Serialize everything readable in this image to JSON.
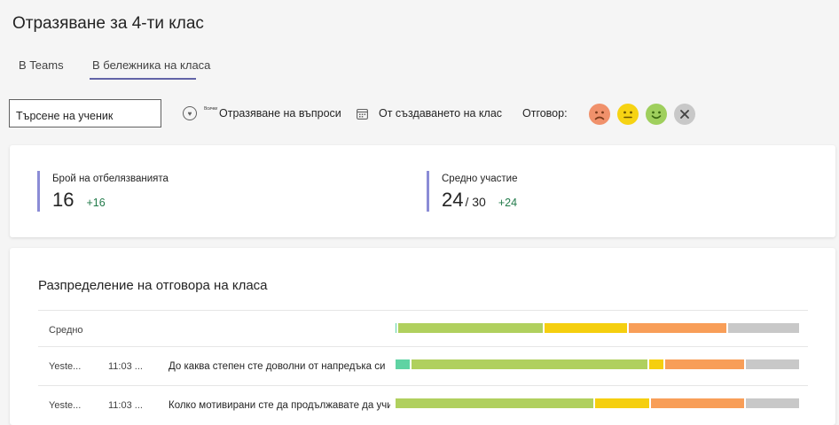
{
  "page": {
    "title": "Отразяване за 4-ти клас"
  },
  "tabs": [
    {
      "label": "В Teams"
    },
    {
      "label": "В бележника на класа"
    }
  ],
  "toolbar": {
    "search_label": "Търсене на ученик",
    "questions_mini_label": "Всички",
    "questions_filter": "Отразяване на въпроси",
    "date_filter": "От създаването на клас",
    "answer_label": "Отговор:"
  },
  "stats": [
    {
      "label": "Брой на отбелязванията",
      "value": "16",
      "of": "",
      "delta": "+16"
    },
    {
      "label": "Средно участие",
      "value": "24",
      "of": "/ 30",
      "delta": "+24"
    }
  ],
  "distribution": {
    "title": "Разпределение на отговора на класа",
    "colors": {
      "teal": "#5fd3a3",
      "green": "#b0d05e",
      "yellow": "#f5cf0f",
      "orange": "#f89e58",
      "gray": "#c8c8c8"
    },
    "rows": [
      {
        "date": "",
        "time": "",
        "question": "Средно",
        "segments": [
          0.2,
          36.5,
          21,
          24.5,
          18
        ]
      },
      {
        "date": "Yeste...",
        "time": "11:03 ...",
        "question": "До каква степен сте доволни от напредъка си",
        "segments": [
          3.5,
          60,
          3.8,
          20,
          13.5
        ]
      },
      {
        "date": "Yeste...",
        "time": "11:03 ...",
        "question": "Колко мотивирани сте да продължавате да учите",
        "segments": [
          0,
          50,
          13.5,
          23.5,
          13.5
        ]
      }
    ]
  }
}
